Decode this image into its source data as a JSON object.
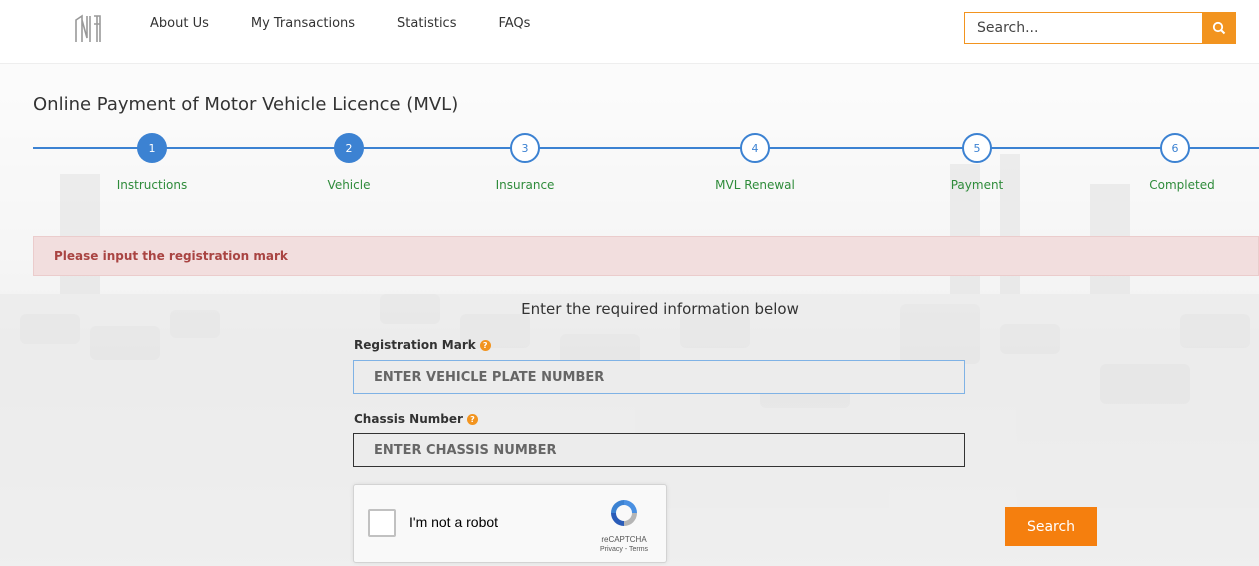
{
  "nav": {
    "items": [
      "About Us",
      "My Transactions",
      "Statistics",
      "FAQs"
    ],
    "search_placeholder": "Search..."
  },
  "page": {
    "title": "Online Payment of Motor Vehicle Licence (MVL)"
  },
  "stepper": {
    "steps": [
      {
        "number": "1",
        "label": "Instructions",
        "state": "active"
      },
      {
        "number": "2",
        "label": "Vehicle",
        "state": "active"
      },
      {
        "number": "3",
        "label": "Insurance",
        "state": "pending"
      },
      {
        "number": "4",
        "label": "MVL Renewal",
        "state": "pending"
      },
      {
        "number": "5",
        "label": "Payment",
        "state": "pending"
      },
      {
        "number": "6",
        "label": "Completed",
        "state": "pending"
      }
    ]
  },
  "alert": {
    "message": "Please input the registration mark"
  },
  "form": {
    "heading": "Enter the required information below",
    "registration_label": "Registration Mark",
    "registration_placeholder": "ENTER VEHICLE PLATE NUMBER",
    "chassis_label": "Chassis Number",
    "chassis_placeholder": "ENTER CHASSIS NUMBER",
    "submit_label": "Search"
  },
  "recaptcha": {
    "label": "I'm not a robot",
    "brand": "reCAPTCHA",
    "terms": "Privacy - Terms"
  },
  "colors": {
    "accent_orange": "#f2941f",
    "button_orange": "#f57f0e",
    "step_blue": "#3c82d2",
    "step_label_green": "#2e8b3a",
    "alert_bg": "#f2dede",
    "alert_text": "#a94442"
  },
  "icons": {
    "logo": "nta-logo",
    "search": "search-icon",
    "help": "help-icon",
    "recaptcha": "recaptcha-logo-icon"
  }
}
